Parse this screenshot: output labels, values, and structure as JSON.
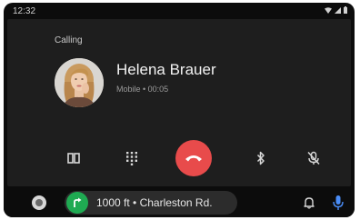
{
  "status_bar": {
    "time": "12:32"
  },
  "call": {
    "status_label": "Calling",
    "contact_name": "Helena Brauer",
    "detail": "Mobile • 00:05"
  },
  "controls": {
    "icons": [
      "dialpad-toggle-icon",
      "keypad-icon",
      "end-call-icon",
      "bluetooth-icon",
      "mute-mic-icon"
    ]
  },
  "navigation": {
    "instruction": "1000 ft • Charleston Rd."
  },
  "colors": {
    "end_call": "#e84b4b",
    "nav_turn": "#1faa52",
    "mic": "#4a8df8",
    "background": "#1e1e1e"
  }
}
